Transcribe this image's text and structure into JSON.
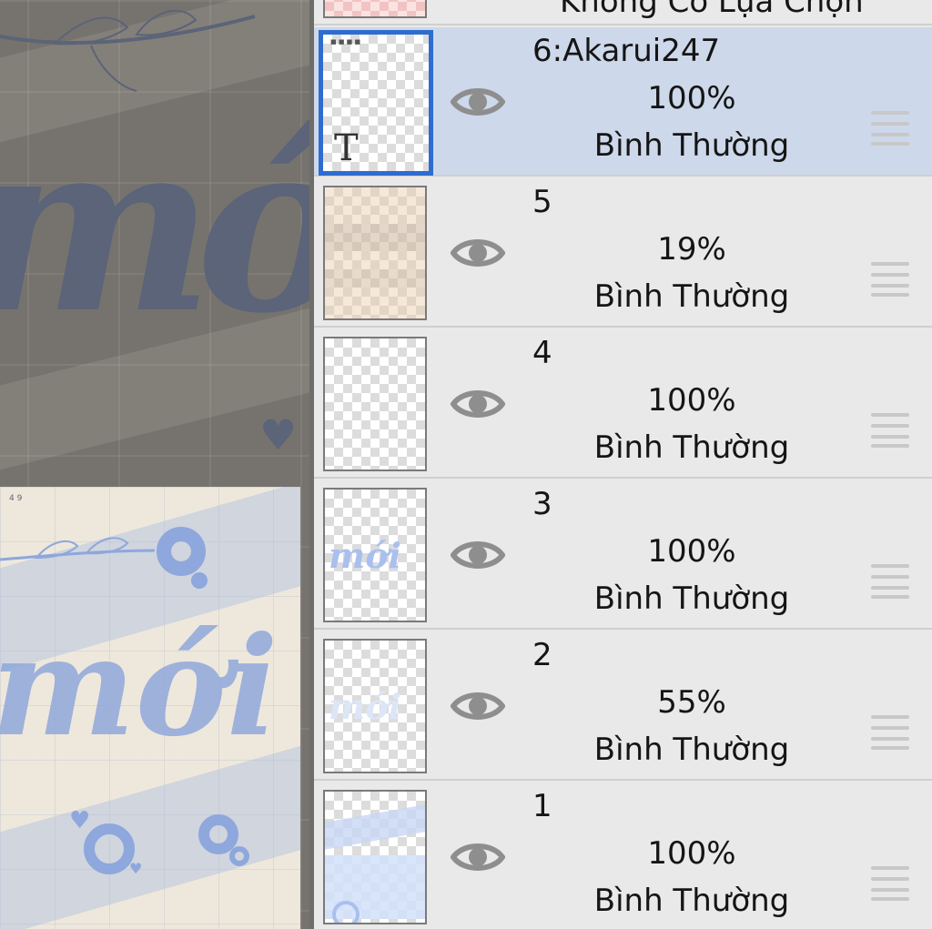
{
  "top_row": {
    "label": "Không Có Lựa Chọn"
  },
  "canvas": {
    "big_word": "mới",
    "preview_word": "mới",
    "preview_small_text": "4  9"
  },
  "layers": [
    {
      "name": "6:Akarui247",
      "opacity": "100%",
      "blend": "Bình Thường",
      "selected": true,
      "thumb": "text",
      "thumb_glyph": "T",
      "visible": true
    },
    {
      "name": "5",
      "opacity": "19%",
      "blend": "Bình Thường",
      "selected": false,
      "thumb": "beige",
      "visible": true
    },
    {
      "name": "4",
      "opacity": "100%",
      "blend": "Bình Thường",
      "selected": false,
      "thumb": "empty",
      "visible": true
    },
    {
      "name": "3",
      "opacity": "100%",
      "blend": "Bình Thường",
      "selected": false,
      "thumb": "word",
      "thumb_word": "mới",
      "visible": true
    },
    {
      "name": "2",
      "opacity": "55%",
      "blend": "Bình Thường",
      "selected": false,
      "thumb": "word-faint",
      "thumb_word": "mới",
      "visible": true
    },
    {
      "name": "1",
      "opacity": "100%",
      "blend": "Bình Thường",
      "selected": false,
      "thumb": "stripes",
      "visible": true
    }
  ],
  "icons": {
    "visibility": "eye-icon",
    "drag": "drag-handle-icon",
    "text_layer": "text-layer-icon"
  },
  "colors": {
    "selected_row": "#cdd8ea",
    "selected_border": "#2f6ccf",
    "panel_bg": "#e9e9e9",
    "accent_blue": "#8ea7dc"
  }
}
